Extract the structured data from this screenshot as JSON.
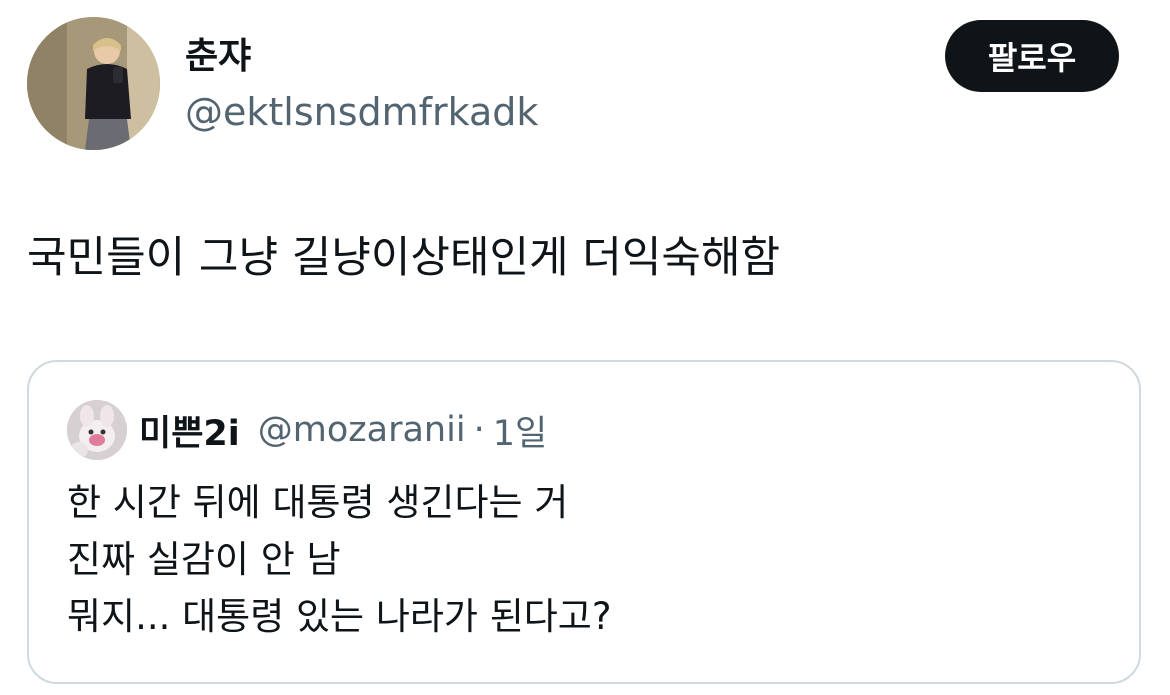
{
  "tweet": {
    "author": {
      "name": "춘쟈",
      "handle": "@ektlsnsdmfrkadk"
    },
    "follow_label": "팔로우",
    "text": "국민들이 그냥 길냥이상태인게 더익숙해함"
  },
  "quoted_tweet": {
    "author": {
      "name": "미쁜2i",
      "handle": "@mozaranii"
    },
    "separator": "·",
    "time": "1일",
    "lines": [
      "한 시간 뒤에 대통령 생긴다는 거",
      "진짜 실감이 안 남",
      "뭐지...  대통령 있는 나라가 된다고?"
    ]
  },
  "colors": {
    "text_primary": "#0f1419",
    "text_secondary": "#536471",
    "button_bg": "#0f1419",
    "border": "#cfd9de"
  }
}
